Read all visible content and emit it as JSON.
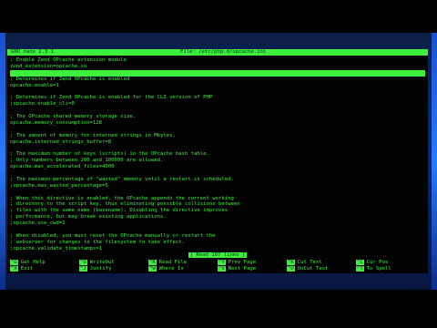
{
  "editor": {
    "app_title": "GNU nano 2.3.1",
    "file_label": "File: /etc/php.d/opcache.ini"
  },
  "content_lines": [
    "; Enable Zend OPcache extension module",
    "zend_extension=opcache.so",
    "",
    "; Determines if Zend OPcache is enabled",
    "opcache.enable=1",
    "",
    "; Determines if Zend OPcache is enabled for the CLI version of PHP",
    ";opcache.enable_cli=0",
    "",
    "; The OPcache shared memory storage size.",
    "opcache.memory_consumption=128",
    "",
    "; The amount of memory for interned strings in Mbytes.",
    "opcache.interned_strings_buffer=8",
    "",
    "; The maximum number of keys (scripts) in the OPcache hash table.",
    "; Only numbers between 200 and 100000 are allowed.",
    "opcache.max_accelerated_files=4000",
    "",
    "; The maximum percentage of \"wasted\" memory until a restart is scheduled.",
    ";opcache.max_wasted_percentage=5",
    "",
    "; When this directive is enabled, the OPcache appends the current working",
    "; directory to the script key, thus eliminating possible collisions between",
    "; files with the same name (basename). Disabling the directive improves",
    "; performance, but may break existing applications.",
    ";opcache.use_cwd=1",
    "",
    "; When disabled, you must reset the OPcache manually or restart the",
    "; webserver for changes to the filesystem to take effect.",
    ";opcache.validate_timestamps=1"
  ],
  "status_message": "[ Read 107 lines ]",
  "shortcuts": {
    "row1": [
      {
        "key": "^G",
        "label": "Get Help"
      },
      {
        "key": "^O",
        "label": "WriteOut"
      },
      {
        "key": "^R",
        "label": "Read File"
      },
      {
        "key": "^Y",
        "label": "Prev Page"
      },
      {
        "key": "^K",
        "label": "Cut Text"
      },
      {
        "key": "^C",
        "label": "Cur Pos"
      }
    ],
    "row2": [
      {
        "key": "^X",
        "label": "Exit"
      },
      {
        "key": "^J",
        "label": "Justify"
      },
      {
        "key": "^W",
        "label": "Where Is"
      },
      {
        "key": "^V",
        "label": "Next Page"
      },
      {
        "key": "^U",
        "label": "UnCut Text"
      },
      {
        "key": "^T",
        "label": "To Spell"
      }
    ]
  },
  "colors": {
    "terminal_bg": "#030303",
    "terminal_fg": "#3cf03c",
    "wallpaper": "#0d2a6a"
  }
}
